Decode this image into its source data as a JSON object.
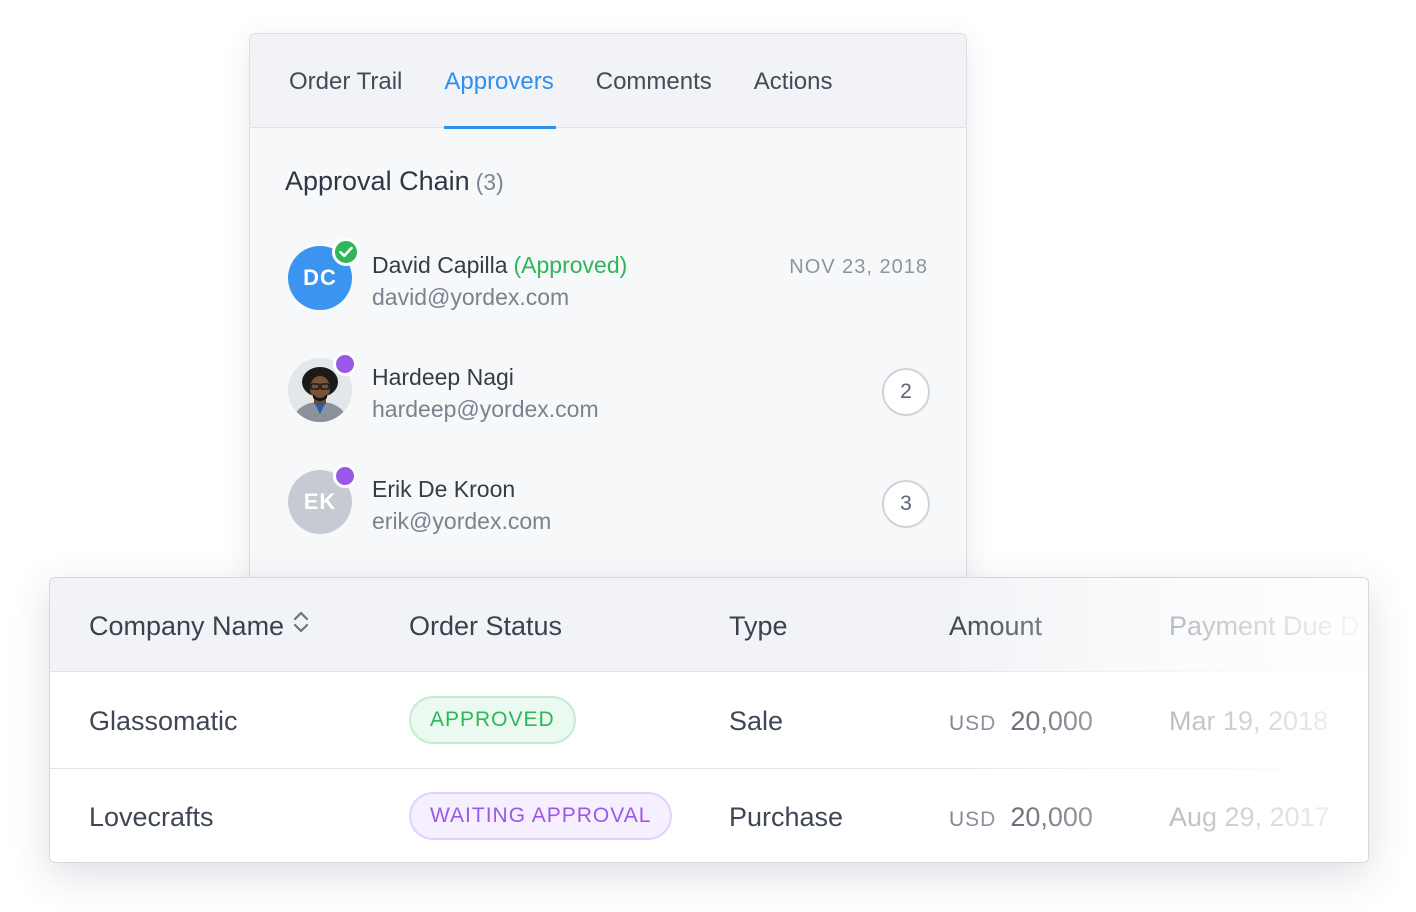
{
  "approvers_panel": {
    "tabs": [
      "Order Trail",
      "Approvers",
      "Comments",
      "Actions"
    ],
    "active_tab": "Approvers",
    "chain_title": "Approval Chain",
    "chain_count": "(3)",
    "approvers": [
      {
        "initials": "DC",
        "name": "David Capilla",
        "status": "(Approved)",
        "email": "david@yordex.com",
        "date": "NOV 23, 2018",
        "avatar_color": "#3b94f0",
        "badge": "check-icon"
      },
      {
        "initials": "",
        "name": "Hardeep Nagi",
        "email": "hardeep@yordex.com",
        "step": "2",
        "avatar": "photo",
        "badge": "pending-dot"
      },
      {
        "initials": "EK",
        "name": "Erik De Kroon",
        "email": "erik@yordex.com",
        "step": "3",
        "avatar_color": "#c6cbd3",
        "badge": "pending-dot"
      }
    ]
  },
  "orders_table": {
    "columns": [
      "Company Name",
      "Order Status",
      "Type",
      "Amount",
      "Payment Due D"
    ],
    "sort_icon": "sort-updown-icon",
    "rows": [
      {
        "company": "Glassomatic",
        "status": "APPROVED",
        "status_color": "#2fb657",
        "type": "Sale",
        "currency": "USD",
        "amount": "20,000",
        "payment_due": "Mar 19, 2018"
      },
      {
        "company": "Lovecrafts",
        "status": "WAITING APPROVAL",
        "status_color": "#9b58e8",
        "type": "Purchase",
        "currency": "USD",
        "amount": "20,000",
        "payment_due": "Aug 29, 2017"
      }
    ]
  },
  "colors": {
    "accent": "#2d8ff0",
    "approved": "#2fb657",
    "pending": "#9b58e8"
  }
}
